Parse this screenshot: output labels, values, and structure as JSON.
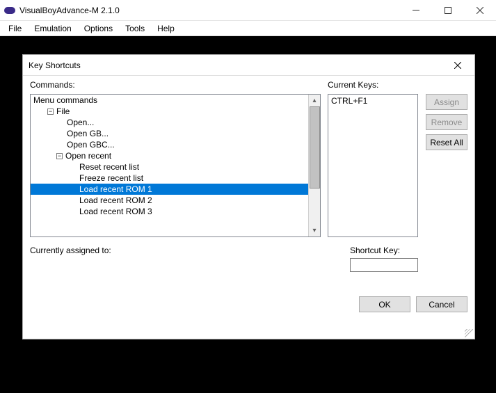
{
  "window": {
    "title": "VisualBoyAdvance-M 2.1.0"
  },
  "menubar": [
    "File",
    "Emulation",
    "Options",
    "Tools",
    "Help"
  ],
  "dialog": {
    "title": "Key Shortcuts",
    "commands_label": "Commands:",
    "current_keys_label": "Current Keys:",
    "currently_assigned_label": "Currently assigned to:",
    "shortcut_key_label": "Shortcut Key:",
    "shortcut_key_value": "",
    "current_keys": [
      "CTRL+F1"
    ],
    "buttons": {
      "assign": "Assign",
      "remove": "Remove",
      "reset_all": "Reset All",
      "ok": "OK",
      "cancel": "Cancel"
    },
    "tree": [
      {
        "label": "Menu commands",
        "level": 1,
        "expander": null
      },
      {
        "label": "File",
        "level": 2,
        "expander": "−"
      },
      {
        "label": "Open...",
        "level": 3,
        "expander": null
      },
      {
        "label": "Open GB...",
        "level": 3,
        "expander": null
      },
      {
        "label": "Open GBC...",
        "level": 3,
        "expander": null
      },
      {
        "label": "Open recent",
        "level": 3,
        "expander": "−",
        "shift": true
      },
      {
        "label": "Reset recent list",
        "level": 4,
        "expander": null
      },
      {
        "label": "Freeze recent list",
        "level": 4,
        "expander": null
      },
      {
        "label": "Load recent ROM 1",
        "level": 4,
        "expander": null,
        "selected": true
      },
      {
        "label": "Load recent ROM 2",
        "level": 4,
        "expander": null
      },
      {
        "label": "Load recent ROM 3",
        "level": 4,
        "expander": null
      }
    ]
  }
}
